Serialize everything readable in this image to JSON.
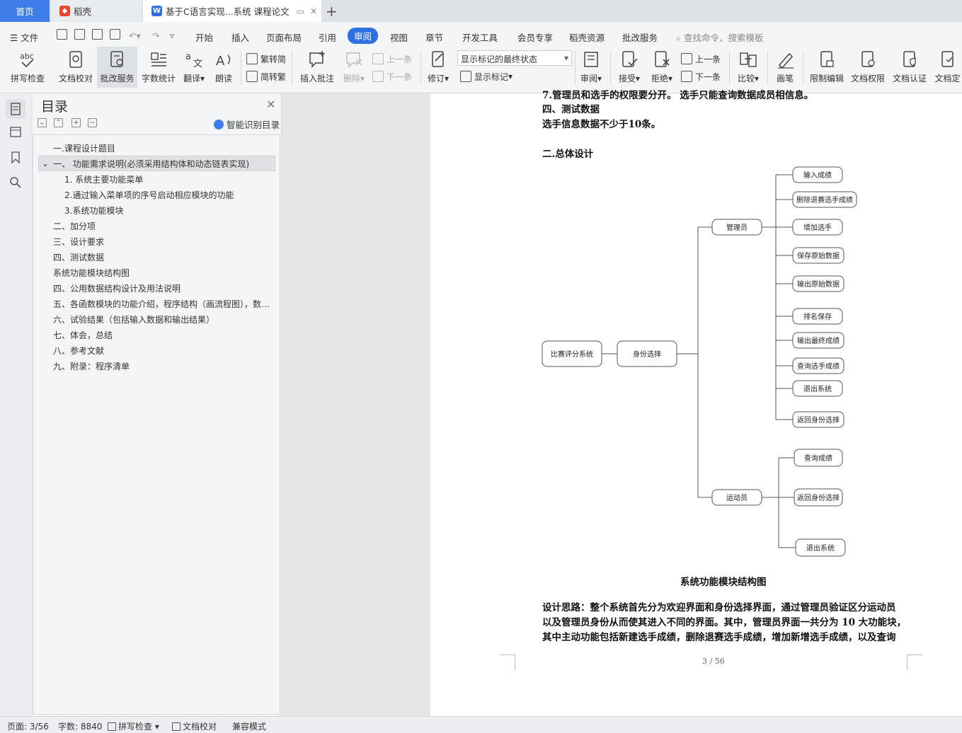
{
  "tabs": {
    "home": "首页",
    "daoke": "稻壳",
    "doc": "基于C语言实现...系统 课程论文"
  },
  "menu": {
    "file": "文件",
    "items": [
      "开始",
      "插入",
      "页面布局",
      "引用",
      "审阅",
      "视图",
      "章节",
      "开发工具",
      "会员专享",
      "稻壳资源",
      "批改服务"
    ],
    "active": "审阅",
    "search_placeholder": "查找命令、搜索模板"
  },
  "ribbon": {
    "spell": "拼写检查",
    "proofread": "文档校对",
    "grading": "批改服务",
    "wordcount": "字数统计",
    "translate": "翻译",
    "read": "朗读",
    "to_trad": "繁转简",
    "to_simp": "简转繁",
    "insert_comment": "插入批注",
    "delete": "删除",
    "prev_comment": "上一条",
    "next_comment": "下一条",
    "revise": "修订",
    "markup_state": "显示标记的最终状态",
    "show_markup": "显示标记",
    "review": "审阅",
    "accept": "接受",
    "reject": "拒绝",
    "prev_change": "上一条",
    "next_change": "下一条",
    "compare": "比较",
    "pen": "画笔",
    "restrict": "限制编辑",
    "permission": "文档权限",
    "certify": "文档认证",
    "finalize": "文档定"
  },
  "nav": {
    "title": "目录",
    "smart": "智能识别目录",
    "items": [
      {
        "text": "一.课程设计题目",
        "level": 1
      },
      {
        "text": "一、  功能需求说明(必须采用结构体和动态链表实现)",
        "level": 1
      },
      {
        "text": "1.  系统主要功能菜单",
        "level": 2
      },
      {
        "text": "2.通过输入菜单项的序号启动相应模块的功能",
        "level": 2
      },
      {
        "text": "3.系统功能模块",
        "level": 2
      },
      {
        "text": "二、加分项",
        "level": 1
      },
      {
        "text": "三、设计要求",
        "level": 1
      },
      {
        "text": "四、测试数据",
        "level": 1
      },
      {
        "text": "系统功能模块结构图",
        "level": 1
      },
      {
        "text": "四、公用数据结构设计及用法说明",
        "level": 1
      },
      {
        "text": "五、各函数模块的功能介绍，程序结构（画流程图），数…",
        "level": 1
      },
      {
        "text": "六、试验结果（包括输入数据和输出结果）",
        "level": 1
      },
      {
        "text": "七、体会，总结",
        "level": 1
      },
      {
        "text": "八、参考文献",
        "level": 1
      },
      {
        "text": "九、附录：程序清单",
        "level": 1
      }
    ]
  },
  "doc": {
    "cut_line": "7.管理员和选手的权限要分开。 选手只能查询数据成员相信息。",
    "heading_test": "四、测试数据",
    "line_test": "选手信息数据不少于10条。",
    "heading_design": "二.总体设计",
    "chart_caption": "系统功能模块结构图",
    "para": [
      "设计思路：整个系统首先分为欢迎界面和身份选择界面，通过管理员验证区分运动员",
      "以及管理员身份从而使其进入不同的界面。其中，管理员界面一共分为 10 大功能块，",
      "其中主动功能包括新建选手成绩，删除退赛选手成绩，增加新增选手成绩，以及查询"
    ],
    "page_no": "3 / 56"
  },
  "diagram": {
    "root": "比赛评分系统",
    "identity": "身份选择",
    "admin": "管理员",
    "athlete": "运动员",
    "admin_items": [
      "输入成绩",
      "删除退赛选手成绩",
      "增加选手",
      "保存原始数据",
      "输出原始数据",
      "排名保存",
      "输出最终成绩",
      "查询选手成绩",
      "退出系统",
      "返回身份选择"
    ],
    "athlete_items": [
      "查询成绩",
      "返回身份选择",
      "退出系统"
    ]
  },
  "status": {
    "page": "页面: 3/56",
    "words": "字数: 8840",
    "spell": "拼写检查",
    "proof": "文档校对",
    "compat": "兼容模式"
  }
}
